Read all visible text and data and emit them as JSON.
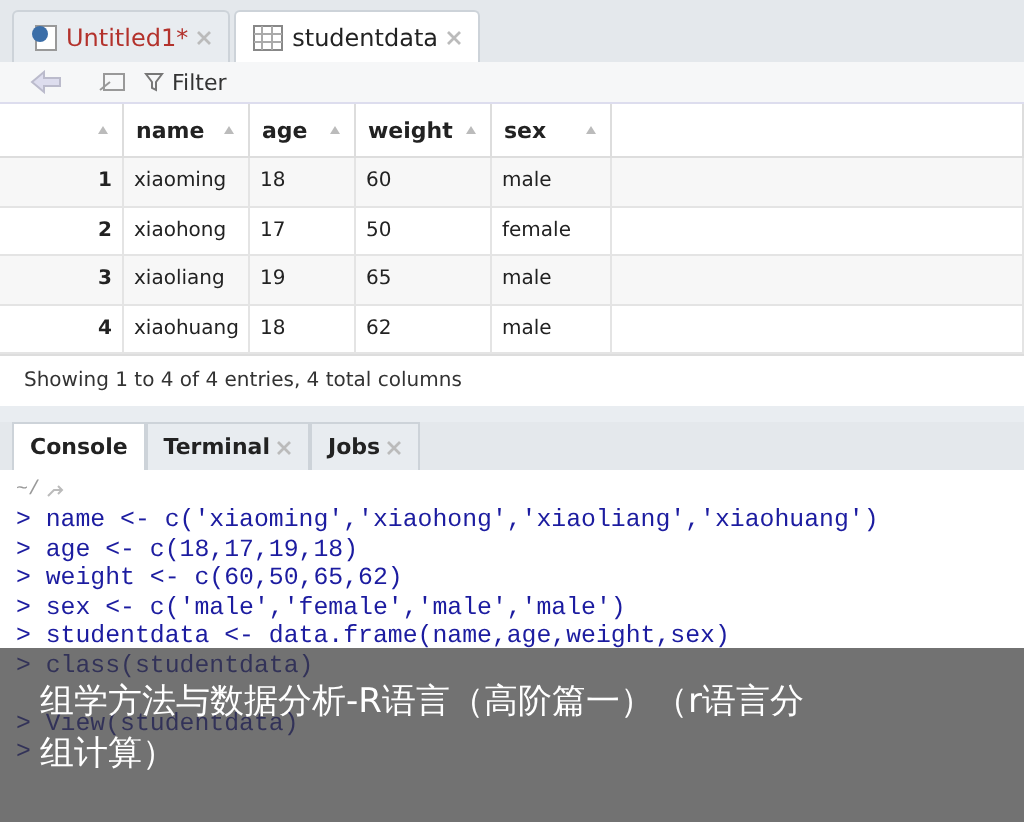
{
  "editor_tabs": [
    {
      "label": "Untitled1*",
      "kind": "script",
      "selected": false
    },
    {
      "label": "studentdata",
      "kind": "data",
      "selected": true
    }
  ],
  "toolbar": {
    "filter": "Filter"
  },
  "table": {
    "columns": [
      "name",
      "age",
      "weight",
      "sex"
    ],
    "rows": [
      {
        "index": "1",
        "cells": [
          "xiaoming",
          "18",
          "60",
          "male"
        ]
      },
      {
        "index": "2",
        "cells": [
          "xiaohong",
          "17",
          "50",
          "female"
        ]
      },
      {
        "index": "3",
        "cells": [
          "xiaoliang",
          "19",
          "65",
          "male"
        ]
      },
      {
        "index": "4",
        "cells": [
          "xiaohuang",
          "18",
          "62",
          "male"
        ]
      }
    ],
    "footer": "Showing 1 to 4 of 4 entries, 4 total columns"
  },
  "console_tabs": [
    {
      "label": "Console",
      "selected": true,
      "closable": false
    },
    {
      "label": "Terminal",
      "selected": false,
      "closable": true
    },
    {
      "label": "Jobs",
      "selected": false,
      "closable": true
    }
  ],
  "console": {
    "path": "~/",
    "lines": [
      "> name <- c('xiaoming','xiaohong','xiaoliang','xiaohuang')",
      "> age <- c(18,17,19,18)",
      "> weight <- c(60,50,65,62)",
      "> sex <- c('male','female','male','male')",
      "> studentdata <- data.frame(name,age,weight,sex)",
      "> class(studentdata)",
      "> View(studentdata)",
      ">"
    ]
  },
  "caption_overlay": "组学方法与数据分析-R语言（高阶篇一）（r语言分组计算）"
}
